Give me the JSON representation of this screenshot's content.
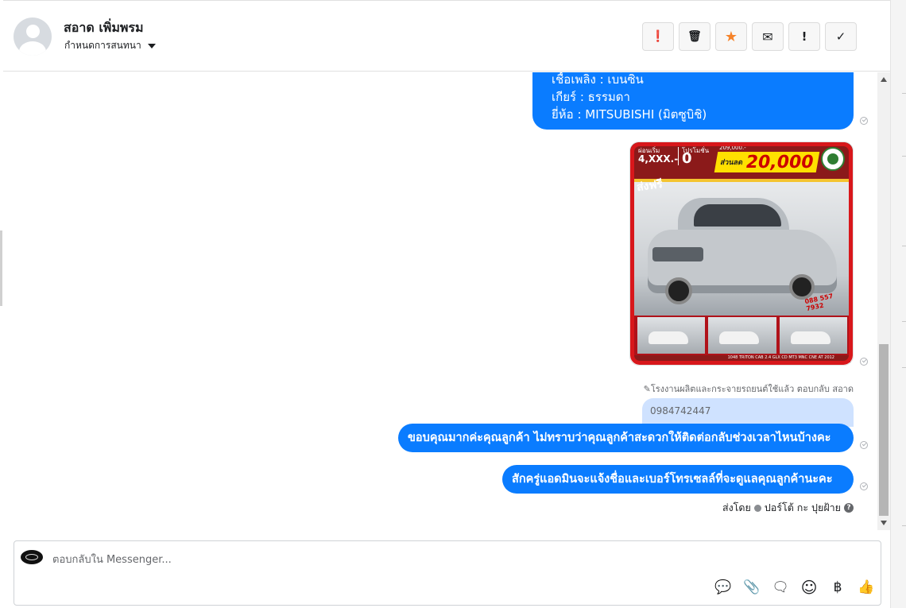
{
  "header": {
    "contact_name": "สอาด เพิ่มพรม",
    "assign_label": "กำหนดการสนทนา",
    "actions": [
      {
        "name": "alert-circle",
        "glyph": "❗"
      },
      {
        "name": "trash",
        "glyph": "🗑"
      },
      {
        "name": "star",
        "glyph": "★",
        "color": "#f5832a"
      },
      {
        "name": "envelope",
        "glyph": "✉"
      },
      {
        "name": "exclamation",
        "glyph": "!"
      },
      {
        "name": "check",
        "glyph": "✓"
      }
    ]
  },
  "thread": {
    "top_bubble_lines": [
      "เชื้อเพลิง : เบนซิน",
      "เกียร์ : ธรรมดา",
      "ยี่ห้อ : MITSUBISHI (มิตซูบิชิ)"
    ],
    "car_ad": {
      "installment_label": "ผ่อนเริ่ม",
      "installment_value": "4,XXX.-",
      "promo_label": "โปรโมชั่น",
      "promo_value": "0",
      "old_price": "209,000.-",
      "discount_label": "ส่วนลด",
      "discount_value": "20,000",
      "free_label": "ส่งฟรี",
      "phone": "088 557 7932",
      "caption": "1048 TRITON CAB 2.4 GLX CD MT3 MNC CNE AT 2012"
    },
    "replied_note": "✎โรงงานผลิตและกระจายรถยนต์ใช้แล้ว ตอบกลับ สอาด",
    "quoted_text": "0984742447",
    "message_1": "ขอบคุณมากค่ะคุณลูกค้า ไม่ทราบว่าคุณลูกค้าสะดวกให้ติดต่อกลับช่วงเวลาไหนบ้างคะ",
    "message_2": "สักครู่แอดมินจะแจ้งชื่อและเบอร์โทรเซลล์ที่จะดูแลคุณลูกค้านะคะ",
    "sent_by_label": "ส่งโดย",
    "sent_by_name": "ปอร์โต้ กะ ปุยฝ้าย",
    "bubble_color": "#0a7cff"
  },
  "composer": {
    "placeholder": "ตอบกลับใน Messenger...",
    "tools": [
      {
        "name": "saved-reply-icon",
        "glyph": "💬"
      },
      {
        "name": "attach-icon",
        "glyph": "📎"
      },
      {
        "name": "chat-icon",
        "glyph": "🗨"
      },
      {
        "name": "emoji-icon",
        "glyph": "☺"
      },
      {
        "name": "baht-icon",
        "glyph": "฿"
      },
      {
        "name": "thumbs-up-icon",
        "glyph": "👍"
      }
    ]
  }
}
